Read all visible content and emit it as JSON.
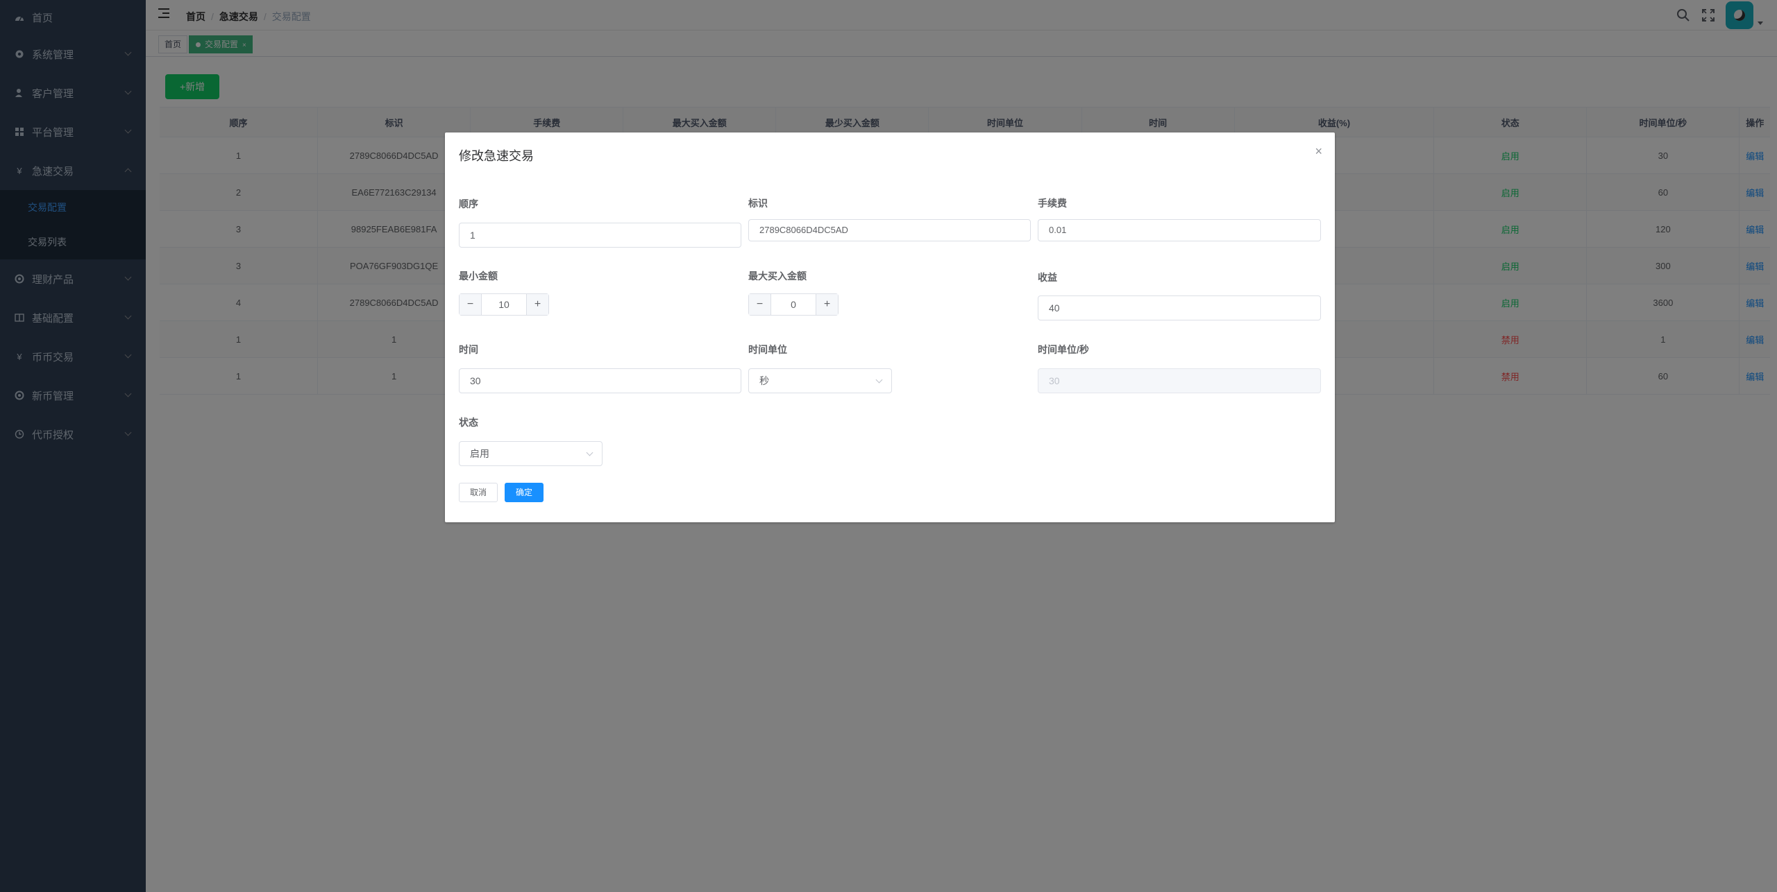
{
  "sidebar": {
    "items": [
      {
        "label": "首页",
        "icon": "dashboard-icon"
      },
      {
        "label": "系统管理",
        "icon": "gear-icon"
      },
      {
        "label": "客户管理",
        "icon": "user-icon"
      },
      {
        "label": "平台管理",
        "icon": "grid-icon"
      },
      {
        "label": "急速交易",
        "icon": "yen-icon"
      },
      {
        "label": "理财产品",
        "icon": "target-icon"
      },
      {
        "label": "基础配置",
        "icon": "book-icon"
      },
      {
        "label": "币币交易",
        "icon": "yen-icon"
      },
      {
        "label": "新币管理",
        "icon": "target-icon"
      },
      {
        "label": "代币授权",
        "icon": "clock-icon"
      }
    ],
    "submenu": [
      {
        "label": "交易配置"
      },
      {
        "label": "交易列表"
      }
    ]
  },
  "navbar": {
    "breadcrumb": [
      "首页",
      "急速交易",
      "交易配置"
    ]
  },
  "tags": {
    "home": "首页",
    "active": "交易配置",
    "close": "×"
  },
  "toolbar": {
    "add_label": "+新增"
  },
  "table": {
    "headers": [
      "顺序",
      "标识",
      "手续费",
      "最大买入金额",
      "最少买入金额",
      "时间单位",
      "时间",
      "收益(%)",
      "状态",
      "时间单位/秒",
      "操作"
    ],
    "rows": [
      {
        "order": "1",
        "id": "2789C8066D4DC5AD",
        "status": "启用",
        "status_on": true,
        "secs": "30",
        "action": "编辑"
      },
      {
        "order": "2",
        "id": "EA6E772163C29134",
        "status": "启用",
        "status_on": true,
        "secs": "60",
        "action": "编辑"
      },
      {
        "order": "3",
        "id": "98925FEAB6E981FA",
        "status": "启用",
        "status_on": true,
        "secs": "120",
        "action": "编辑"
      },
      {
        "order": "3",
        "id": "POA76GF903DG1QE",
        "status": "启用",
        "status_on": true,
        "secs": "300",
        "action": "编辑"
      },
      {
        "order": "4",
        "id": "2789C8066D4DC5AD",
        "status": "启用",
        "status_on": true,
        "secs": "3600",
        "action": "编辑"
      },
      {
        "order": "1",
        "id": "1",
        "status": "禁用",
        "status_on": false,
        "secs": "1",
        "action": "编辑"
      },
      {
        "order": "1",
        "id": "1",
        "status": "禁用",
        "status_on": false,
        "secs": "60",
        "action": "编辑"
      }
    ]
  },
  "dialog": {
    "title": "修改急速交易",
    "close": "×",
    "fields": {
      "order": {
        "label": "顺序",
        "value": "1"
      },
      "identifier": {
        "label": "标识",
        "value": "2789C8066D4DC5AD"
      },
      "fee": {
        "label": "手续费",
        "value": "0.01"
      },
      "min_amount": {
        "label": "最小金额",
        "value": "10"
      },
      "max_buy": {
        "label": "最大买入金额",
        "value": "0"
      },
      "profit": {
        "label": "收益",
        "value": "40"
      },
      "time": {
        "label": "时间",
        "value": "30"
      },
      "time_unit": {
        "label": "时间单位",
        "value": "秒"
      },
      "time_unit_sec": {
        "label": "时间单位/秒",
        "value": "30"
      },
      "status": {
        "label": "状态",
        "value": "启用"
      }
    },
    "cancel_label": "取消",
    "ok_label": "确定"
  },
  "colors": {
    "sidebar_bg": "#304156",
    "accent": "#1890ff",
    "success": "#13ce66",
    "danger": "#ff4949",
    "tag_active": "#42b983"
  }
}
